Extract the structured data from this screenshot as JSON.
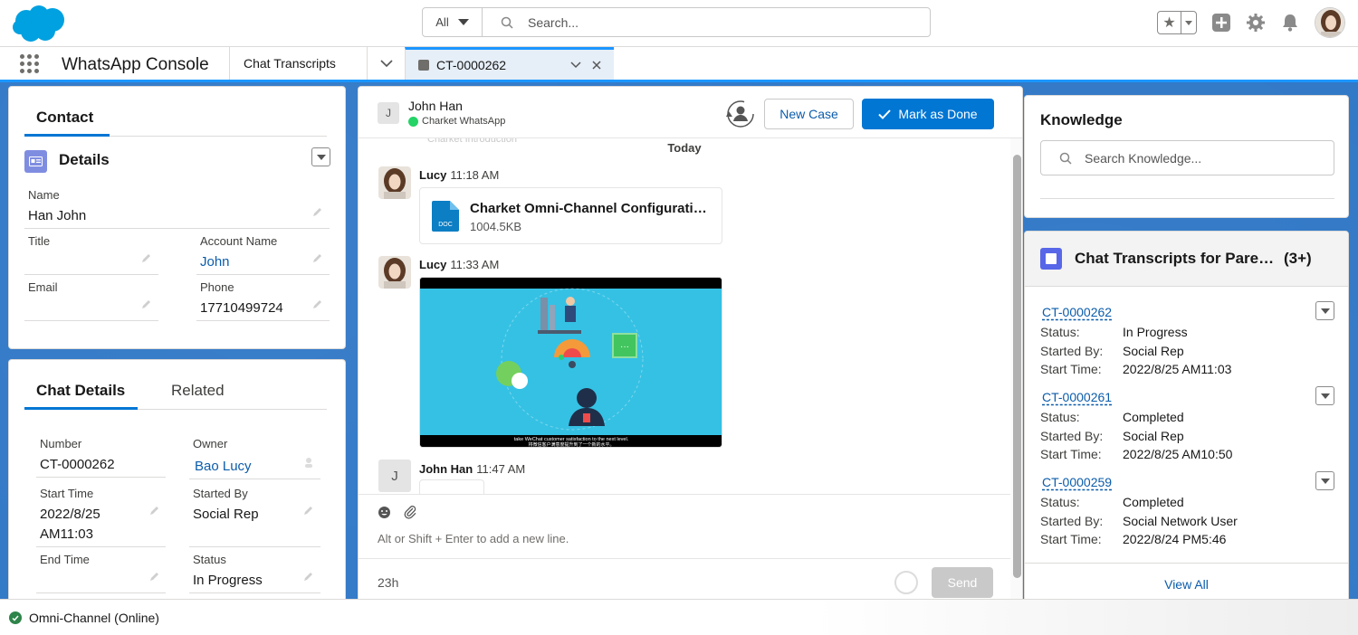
{
  "header": {
    "search_scope": "All",
    "search_placeholder": "Search..."
  },
  "nav": {
    "app_name": "WhatsApp Console",
    "tab_object": "Chat Transcripts",
    "active_tab": "CT-0000262"
  },
  "contact": {
    "tab_label": "Contact",
    "section_title": "Details",
    "fields": {
      "name_label": "Name",
      "name_value": "Han John",
      "title_label": "Title",
      "title_value": "",
      "account_label": "Account Name",
      "account_value": "John",
      "email_label": "Email",
      "email_value": "",
      "phone_label": "Phone",
      "phone_value": "17710499724"
    }
  },
  "chat_details": {
    "tab_active": "Chat Details",
    "tab_related": "Related",
    "fields": {
      "number_label": "Number",
      "number_value": "CT-0000262",
      "owner_label": "Owner",
      "owner_value": "Bao Lucy",
      "start_label": "Start Time",
      "start_value_line1": "2022/8/25",
      "start_value_line2": "AM11:03",
      "started_by_label": "Started By",
      "started_by_value": "Social Rep",
      "end_label": "End Time",
      "end_value": "",
      "status_label": "Status",
      "status_value": "In Progress"
    }
  },
  "conversation": {
    "contact_initial": "J",
    "contact_name": "John Han",
    "channel": "Charket WhatsApp",
    "new_case_label": "New Case",
    "mark_done_label": "Mark as Done",
    "ghost_text": "Charket Introduction",
    "day_divider": "Today",
    "messages": [
      {
        "sender": "Lucy",
        "time": "11:18 AM",
        "file_name": "Charket Omni-Channel Configuration Guide",
        "file_size": "1004.5KB",
        "file_type": "DOC"
      },
      {
        "sender": "Lucy",
        "time": "11:33 AM",
        "video_caption_1": "take WeChat customer satisfaction to the next level.",
        "video_caption_2": "将微信客户满意度提升到了一个新的水平。"
      },
      {
        "sender": "John Han",
        "time": "11:47 AM",
        "initial": "J"
      }
    ],
    "composer_placeholder": "Alt or Shift + Enter to add a new line.",
    "timer": "23h",
    "send_label": "Send"
  },
  "knowledge": {
    "title": "Knowledge",
    "search_placeholder": "Search Knowledge..."
  },
  "transcripts": {
    "title": "Chat Transcripts for Parent Chat Transcript",
    "count": "(3+)",
    "status_label": "Status:",
    "started_by_label": "Started By:",
    "start_time_label": "Start Time:",
    "records": [
      {
        "id": "CT-0000262",
        "status": "In Progress",
        "started_by": "Social Rep",
        "start_time": "2022/8/25 AM11:03"
      },
      {
        "id": "CT-0000261",
        "status": "Completed",
        "started_by": "Social Rep",
        "start_time": "2022/8/25 AM10:50"
      },
      {
        "id": "CT-0000259",
        "status": "Completed",
        "started_by": "Social Network User",
        "start_time": "2022/8/24 PM5:46"
      }
    ],
    "view_all": "View All"
  },
  "utility": {
    "omni_status": "Omni-Channel (Online)"
  },
  "colors": {
    "brand_blue": "#0176d3",
    "salesforce_cloud": "#00a1e0",
    "workspace_bg": "#2f77c6",
    "online_green": "#2e844a"
  }
}
